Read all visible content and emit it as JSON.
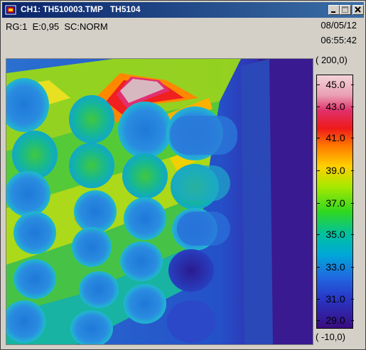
{
  "window": {
    "title": "CH1: TH510003.TMP   TH5104",
    "buttons": [
      "minimize",
      "maximize",
      "close"
    ]
  },
  "info": {
    "status_line": "RG:1  E:0,95  SC:NORM",
    "date": "08/05/12",
    "time": "06:55:42"
  },
  "scale": {
    "max_label": "( 200,0)",
    "min_label": "( -10,0)",
    "ticks": [
      "45.0",
      "43.0",
      "41.0",
      "39.0",
      "37.0",
      "35.0",
      "33.0",
      "31.0",
      "29.0"
    ],
    "gradient_colors": [
      "#f2d4d8",
      "#e0306a",
      "#ee1a1a",
      "#ff7a00",
      "#ffd000",
      "#a8e800",
      "#30d820",
      "#00c0a0",
      "#00a8d8",
      "#2068e0",
      "#3a0c80"
    ]
  },
  "thermal_image": {
    "subject": "stacked cylindrical cells viewed end-on",
    "hotspot_color": "#d8b8c0",
    "background_color": "#3a1a8a"
  }
}
